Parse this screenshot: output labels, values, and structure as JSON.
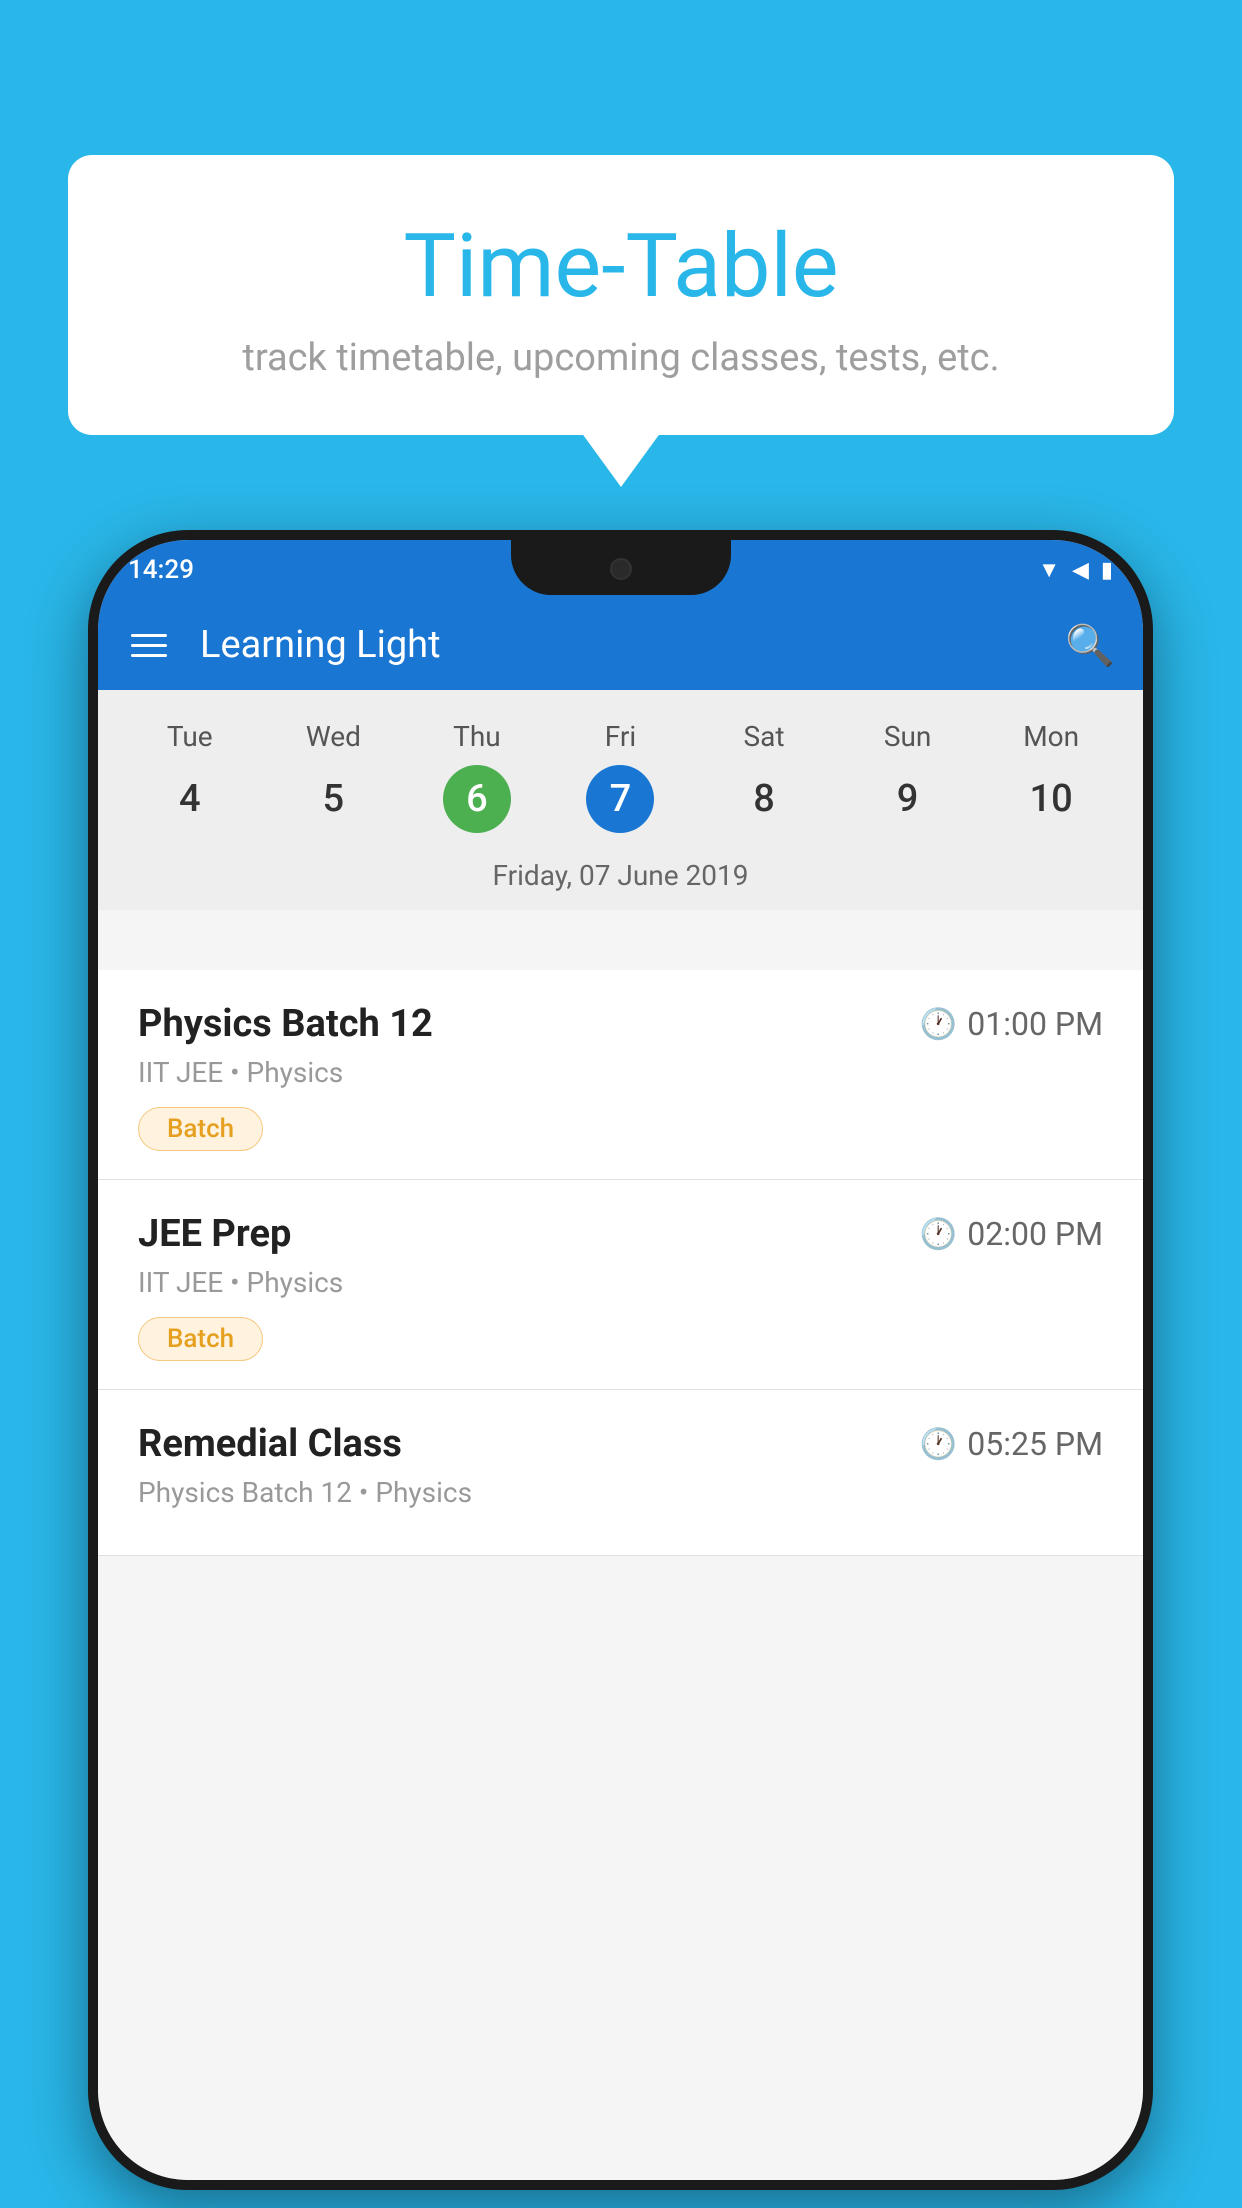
{
  "background": {
    "color": "#29b6e8"
  },
  "speech_bubble": {
    "title": "Time-Table",
    "subtitle": "track timetable, upcoming classes, tests, etc."
  },
  "phone": {
    "status_bar": {
      "time": "14:29",
      "signal_icons": [
        "wifi",
        "signal",
        "battery"
      ]
    },
    "app_bar": {
      "title": "Learning Light",
      "menu_icon": "hamburger",
      "search_icon": "search"
    },
    "calendar": {
      "days": [
        {
          "label": "Tue",
          "number": "4",
          "state": "normal"
        },
        {
          "label": "Wed",
          "number": "5",
          "state": "normal"
        },
        {
          "label": "Thu",
          "number": "6",
          "state": "today"
        },
        {
          "label": "Fri",
          "number": "7",
          "state": "selected"
        },
        {
          "label": "Sat",
          "number": "8",
          "state": "normal"
        },
        {
          "label": "Sun",
          "number": "9",
          "state": "normal"
        },
        {
          "label": "Mon",
          "number": "10",
          "state": "normal"
        }
      ],
      "selected_date_label": "Friday, 07 June 2019"
    },
    "schedule": {
      "items": [
        {
          "title": "Physics Batch 12",
          "time": "01:00 PM",
          "subtitle": "IIT JEE • Physics",
          "badge": "Batch"
        },
        {
          "title": "JEE Prep",
          "time": "02:00 PM",
          "subtitle": "IIT JEE • Physics",
          "badge": "Batch"
        },
        {
          "title": "Remedial Class",
          "time": "05:25 PM",
          "subtitle": "Physics Batch 12 • Physics",
          "badge": null
        }
      ]
    }
  }
}
